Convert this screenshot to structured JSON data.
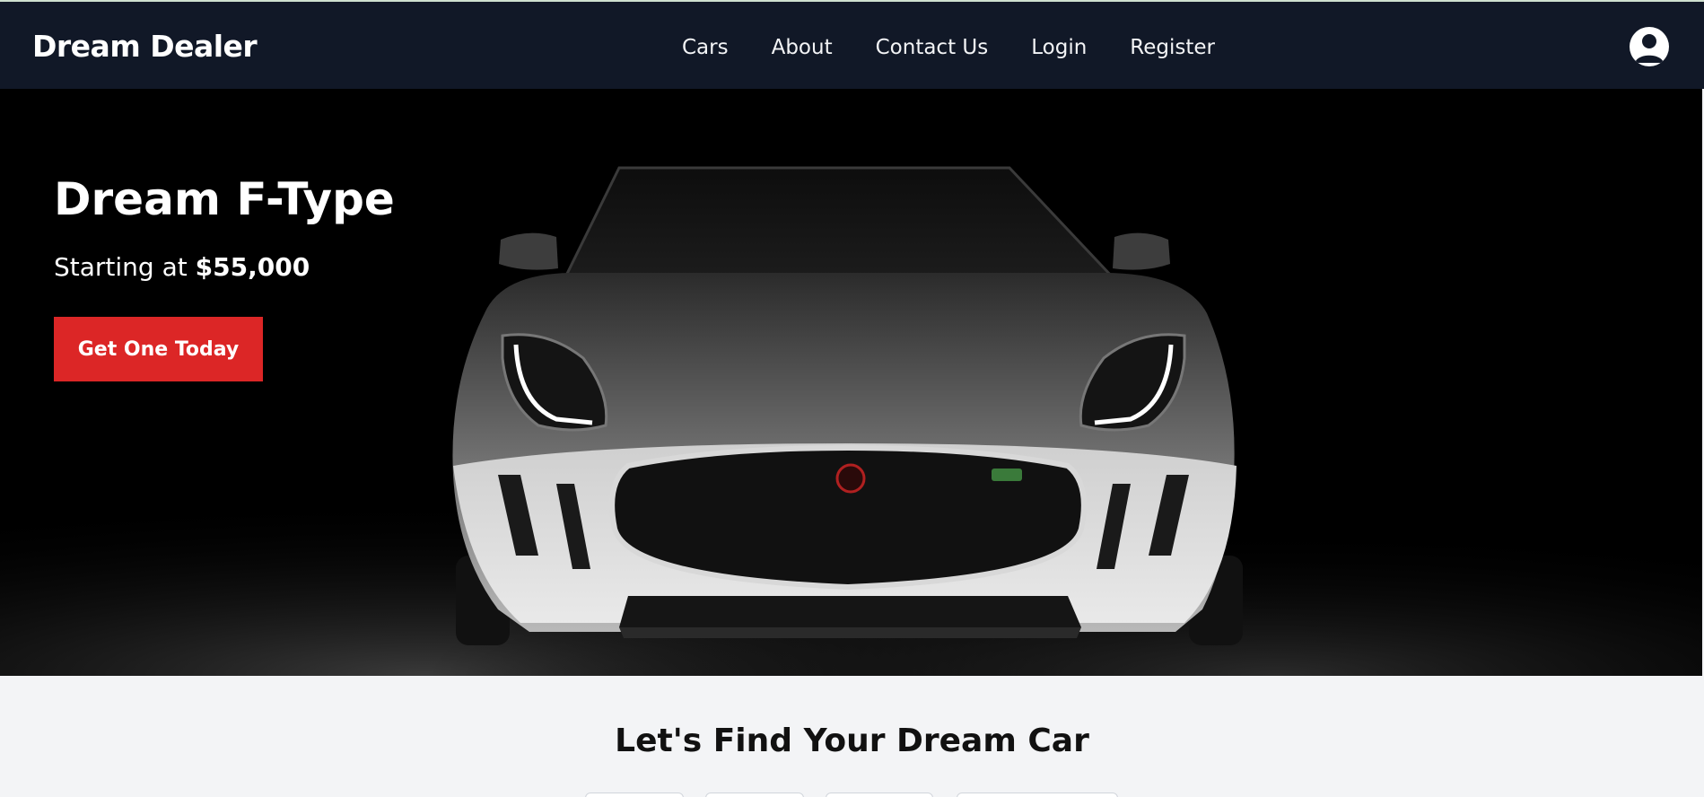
{
  "navbar": {
    "brand": "Dream Dealer",
    "links": [
      "Cars",
      "About",
      "Contact Us",
      "Login",
      "Register"
    ],
    "user_icon": "user-circle-icon"
  },
  "hero": {
    "title": "Dream F-Type",
    "subtitle_prefix": "Starting at",
    "price": "$55,000",
    "cta_label": "Get One Today",
    "image": "white sports car front view on dark background"
  },
  "find": {
    "title": "Let's Find Your Dream Car"
  },
  "colors": {
    "navbar_bg": "#111827",
    "accent": "#dc2626",
    "page_bg": "#f3f4f6",
    "hero_bg": "#000000"
  }
}
